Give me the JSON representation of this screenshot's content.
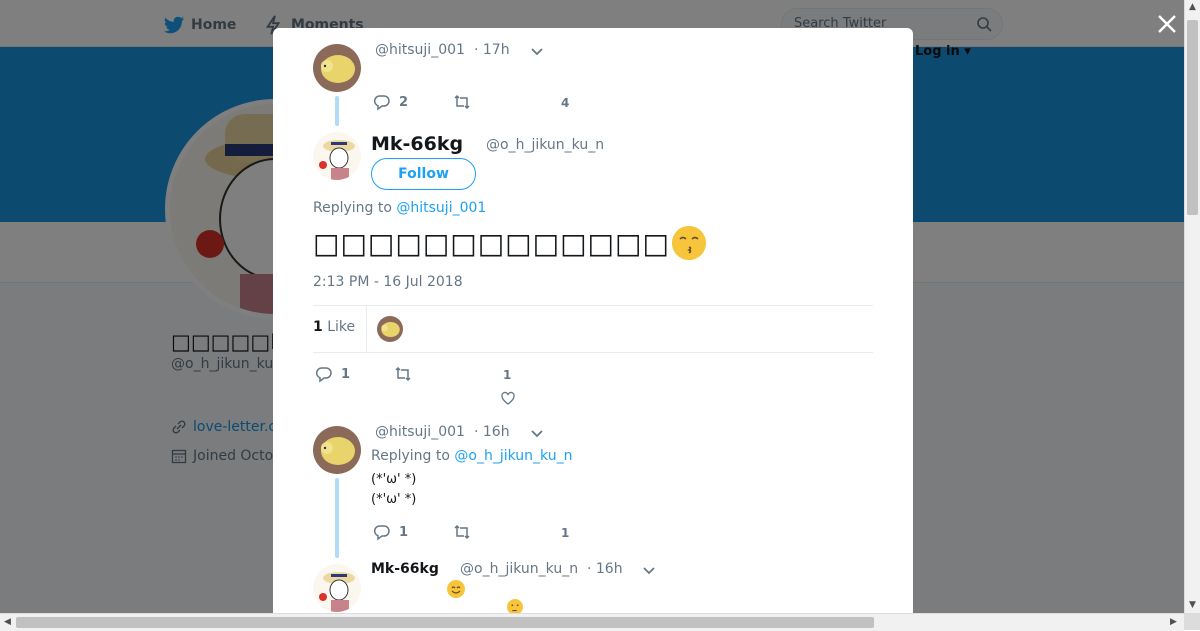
{
  "nav": {
    "home": "Home",
    "moments": "Moments",
    "search_placeholder": "Search Twitter",
    "login": "Log in ▾"
  },
  "background_profile": {
    "name": "□□□□□Mk-",
    "handle": "@o_h_jikun_ku",
    "link": "love-letter.c",
    "joined": "Joined Octo"
  },
  "modal": {
    "parent_tweet": {
      "handle": "@hitsuji_001",
      "time": "· 17h",
      "replies": "2",
      "likes": "4"
    },
    "main_tweet": {
      "name": "Mk-66kg",
      "handle": "@o_h_jikun_ku_n",
      "follow_label": "Follow",
      "replying_prefix": "Replying to",
      "replying_to": "@hitsuji_001",
      "text": "□□□□□□□□□□□□□",
      "timestamp": "2:13 PM - 16 Jul 2018",
      "like_count": "1",
      "like_label": "Like",
      "replies": "1",
      "likes": "1"
    },
    "reply_1": {
      "handle": "@hitsuji_001",
      "time": "· 16h",
      "replying_prefix": "Replying to",
      "replying_to": "@o_h_jikun_ku_n",
      "line1": "(*'ω' *)",
      "line2": "(*'ω' *)",
      "replies": "1",
      "likes": "1"
    },
    "reply_2": {
      "name": "Mk-66kg",
      "handle": "@o_h_jikun_ku_n",
      "time": "· 16h"
    }
  },
  "icons": {
    "close": "close-icon",
    "reply": "reply-icon",
    "retweet": "retweet-icon",
    "heart": "heart-icon",
    "chevron": "chevron-down-icon",
    "twitter": "twitter-bird-icon",
    "moments": "lightning-icon",
    "search": "search-icon",
    "link": "link-icon",
    "calendar": "calendar-icon"
  },
  "colors": {
    "accent": "#1da1f2",
    "banner": "#1b95e0",
    "thread_line": "#b0dcf5"
  }
}
